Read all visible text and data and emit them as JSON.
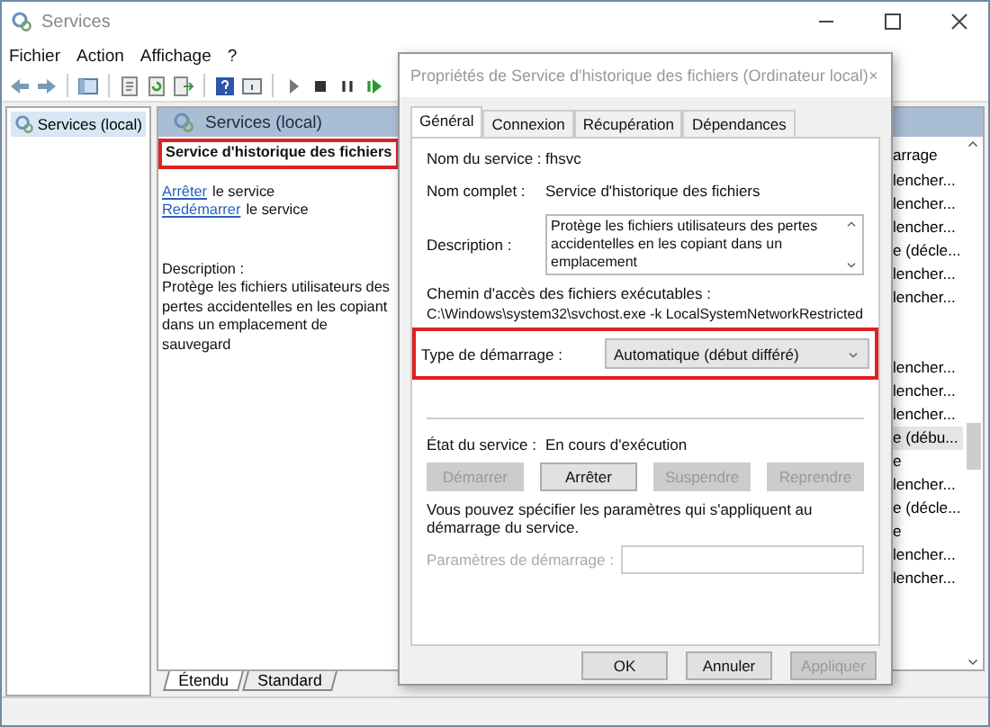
{
  "window": {
    "title": "Services"
  },
  "menu": [
    "Fichier",
    "Action",
    "Affichage",
    "?"
  ],
  "tree": {
    "items": [
      {
        "label": "Services (local)",
        "selected": true
      }
    ]
  },
  "panel": {
    "header": "Services (local)",
    "service_name": {
      "text": "Service d'historique des fichiers",
      "highlighted": true
    },
    "actions": [
      {
        "link": "Arrêter",
        "text": "le service"
      },
      {
        "link": "Redémarrer",
        "text": "le service"
      }
    ],
    "description_label": "Description :",
    "description": "Protège les fichiers utilisateurs des pertes accidentelles en les copiant dans un emplacement de sauvegard"
  },
  "list": {
    "column_header": "arrage",
    "rows": [
      {
        "kind": "entry",
        "text": "lencher...",
        "selected": false
      },
      {
        "kind": "entry",
        "text": "lencher...",
        "selected": false
      },
      {
        "kind": "entry",
        "text": "lencher...",
        "selected": false
      },
      {
        "kind": "entry",
        "text": "e (décle...",
        "selected": false
      },
      {
        "kind": "entry",
        "text": "lencher...",
        "selected": false
      },
      {
        "kind": "entry",
        "text": "lencher...",
        "selected": false
      },
      {
        "kind": "blank"
      },
      {
        "kind": "blank"
      },
      {
        "kind": "entry",
        "text": "lencher...",
        "selected": false
      },
      {
        "kind": "entry",
        "text": "lencher...",
        "selected": false
      },
      {
        "kind": "entry",
        "text": "lencher...",
        "selected": false
      },
      {
        "kind": "entry",
        "text": "e (débu...",
        "selected": true
      },
      {
        "kind": "entry",
        "text": "e",
        "selected": false
      },
      {
        "kind": "entry",
        "text": "lencher...",
        "selected": false
      },
      {
        "kind": "entry",
        "text": "e (décle...",
        "selected": false
      },
      {
        "kind": "entry",
        "text": "e",
        "selected": false
      },
      {
        "kind": "entry",
        "text": "lencher...",
        "selected": false
      },
      {
        "kind": "entry",
        "text": "lencher...",
        "selected": false
      }
    ]
  },
  "view_tabs": [
    {
      "label": "Étendu",
      "selected": true
    },
    {
      "label": "Standard",
      "selected": false
    }
  ],
  "dialog": {
    "title": "Propriétés de Service d'historique des fichiers (Ordinateur local)",
    "tabs": [
      {
        "label": "Général",
        "selected": true
      },
      {
        "label": "Connexion",
        "selected": false
      },
      {
        "label": "Récupération",
        "selected": false
      },
      {
        "label": "Dépendances",
        "selected": false
      }
    ],
    "fields": [
      {
        "label": "Nom du service :",
        "value": "fhsvc"
      },
      {
        "label": "Nom complet :",
        "value": "Service d'historique des fichiers"
      }
    ],
    "description": {
      "label": "Description :",
      "value": "Protège les fichiers utilisateurs des pertes accidentelles en les copiant dans un emplacement"
    },
    "path": {
      "label": "Chemin d'accès des fichiers exécutables :",
      "value": "C:\\Windows\\system32\\svchost.exe -k LocalSystemNetworkRestricted"
    },
    "startup_type": {
      "label": "Type de démarrage :",
      "value": "Automatique (début différé)",
      "highlighted": true
    },
    "status": {
      "label": "État du service :",
      "value": "En cours d'exécution"
    },
    "service_buttons": [
      {
        "label": "Démarrer",
        "disabled": true
      },
      {
        "label": "Arrêter",
        "disabled": false
      },
      {
        "label": "Suspendre",
        "disabled": true
      },
      {
        "label": "Reprendre",
        "disabled": true
      }
    ],
    "note": "Vous pouvez spécifier les paramètres qui s'appliquent au démarrage du service.",
    "parameters": {
      "label": "Paramètres de démarrage :",
      "disabled": true
    },
    "buttons": [
      {
        "label": "OK",
        "disabled": false
      },
      {
        "label": "Annuler",
        "disabled": false
      },
      {
        "label": "Appliquer",
        "disabled": true
      }
    ]
  }
}
